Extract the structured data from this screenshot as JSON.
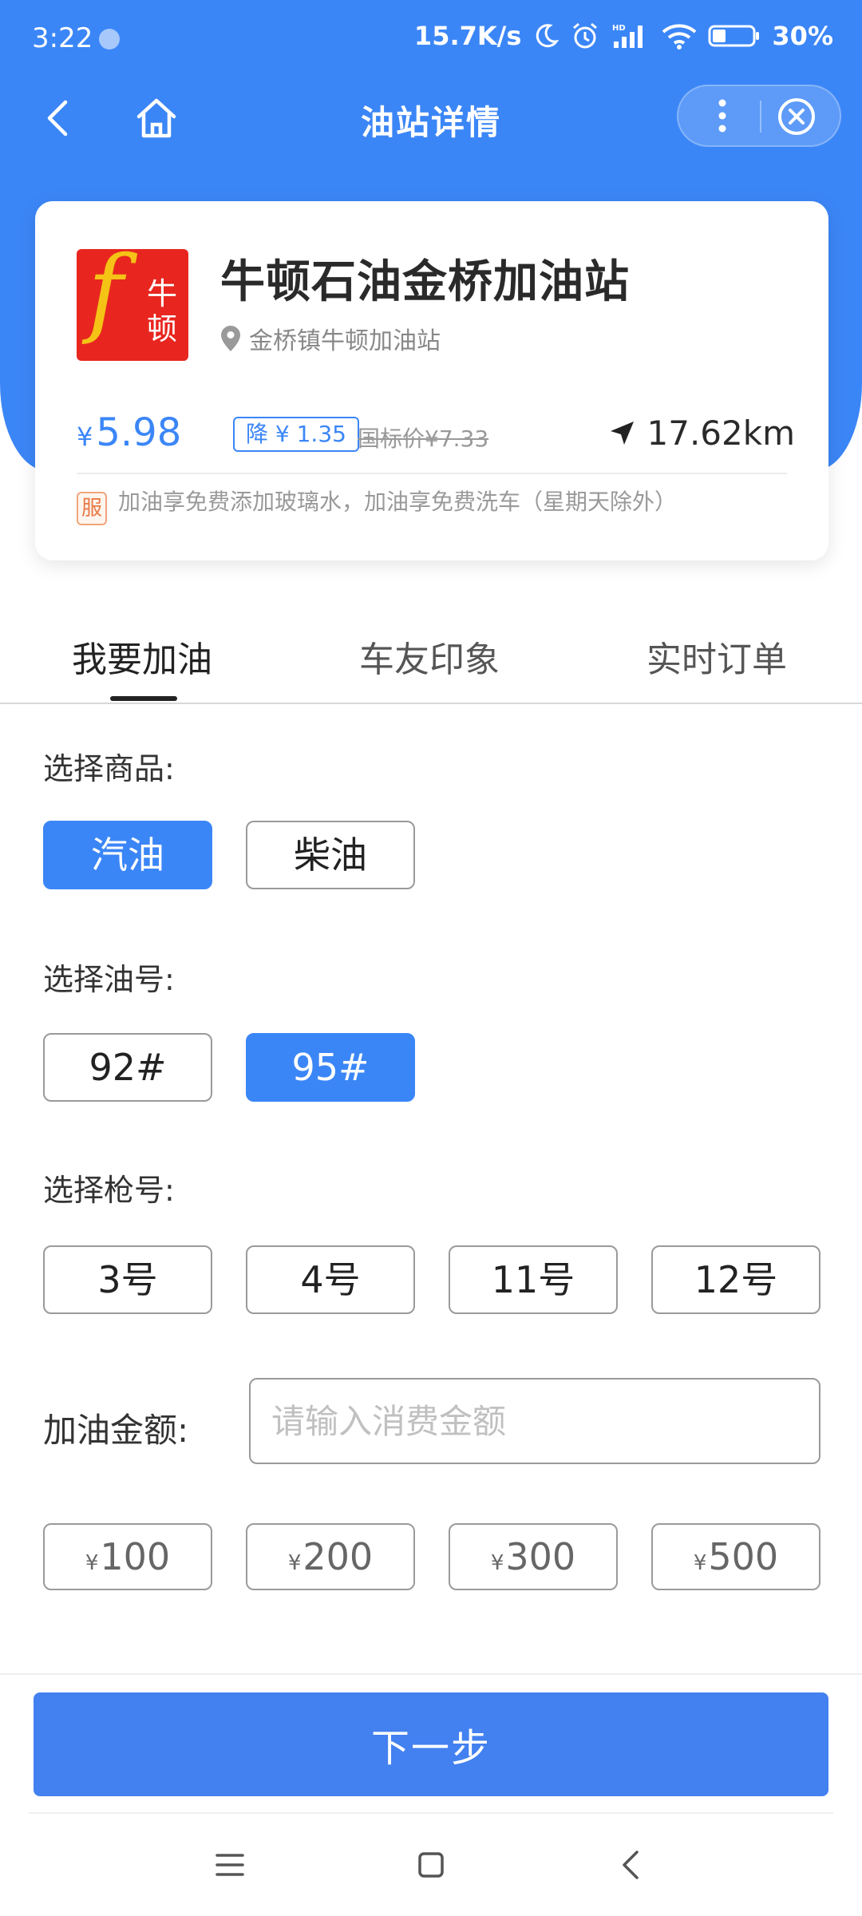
{
  "status_bar": {
    "time": "3:22",
    "network_speed": "15.7K/s",
    "battery": "30%",
    "icons": [
      "moon-icon",
      "alarm-icon",
      "signal-icon",
      "wifi-icon",
      "battery-icon"
    ]
  },
  "title_bar": {
    "title": "油站详情",
    "icons": [
      "back-icon",
      "home-icon",
      "more-icon",
      "close-icon"
    ]
  },
  "station": {
    "logo_text": "牛顿",
    "logo_letter": "f",
    "name": "牛顿石油金桥加油站",
    "address": "金桥镇牛顿加油站",
    "price_currency": "¥",
    "price": "5.98",
    "discount": "降 ¥ 1.35",
    "national_price": "国标价¥7.33",
    "distance": "17.62km",
    "service_tag": "服",
    "service_text": "加油享免费添加玻璃水，加油享免费洗车（星期天除外）"
  },
  "tabs": [
    {
      "label": "我要加油",
      "active": true
    },
    {
      "label": "车友印象",
      "active": false
    },
    {
      "label": "实时订单",
      "active": false
    }
  ],
  "goods": {
    "label": "选择商品:",
    "options": [
      {
        "label": "汽油",
        "selected": true
      },
      {
        "label": "柴油",
        "selected": false
      }
    ]
  },
  "oil_number": {
    "label": "选择油号:",
    "options": [
      {
        "label": "92#",
        "selected": false
      },
      {
        "label": "95#",
        "selected": true
      }
    ]
  },
  "gun_number": {
    "label": "选择枪号:",
    "options": [
      {
        "label": "3号",
        "selected": false
      },
      {
        "label": "4号",
        "selected": false
      },
      {
        "label": "11号",
        "selected": false
      },
      {
        "label": "12号",
        "selected": false
      }
    ]
  },
  "amount": {
    "label": "加油金额:",
    "placeholder": "请输入消费金额",
    "value": "",
    "currency": "¥",
    "quick_amounts": [
      "100",
      "200",
      "300",
      "500"
    ]
  },
  "next_button": "下一步",
  "colors": {
    "primary": "#3b86f7",
    "button": "#4380f0",
    "service_tag": "#e87a45"
  }
}
